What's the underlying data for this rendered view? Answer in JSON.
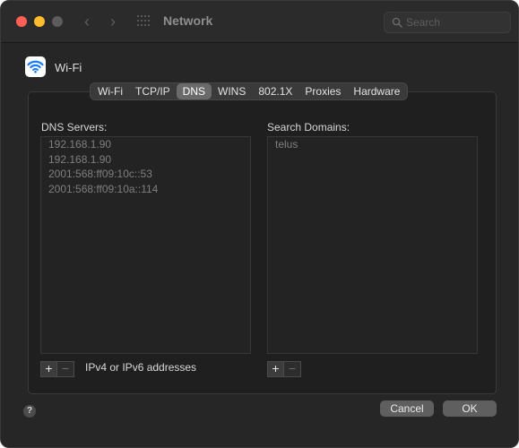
{
  "window": {
    "title": "Network",
    "search_placeholder": "Search"
  },
  "interface": {
    "name": "Wi-Fi",
    "icon": "wifi-icon"
  },
  "tabs": [
    {
      "label": "Wi-Fi",
      "active": false
    },
    {
      "label": "TCP/IP",
      "active": false
    },
    {
      "label": "DNS",
      "active": true
    },
    {
      "label": "WINS",
      "active": false
    },
    {
      "label": "802.1X",
      "active": false
    },
    {
      "label": "Proxies",
      "active": false
    },
    {
      "label": "Hardware",
      "active": false
    }
  ],
  "dns": {
    "label": "DNS Servers:",
    "servers": [
      "192.168.1.90",
      "192.168.1.90",
      "2001:568:ff09:10c::53",
      "2001:568:ff09:10a::114"
    ],
    "add_label": "+",
    "remove_label": "−",
    "hint": "IPv4 or IPv6 addresses"
  },
  "search_domains": {
    "label": "Search Domains:",
    "domains": [
      "telus"
    ],
    "add_label": "+",
    "remove_label": "−"
  },
  "footer": {
    "help_label": "?",
    "cancel_label": "Cancel",
    "ok_label": "OK"
  },
  "colors": {
    "close": "#ff5f57",
    "minimize": "#febc2e",
    "accent_tab": "#6a6a6a",
    "wifi_blue": "#1a7cf5"
  }
}
